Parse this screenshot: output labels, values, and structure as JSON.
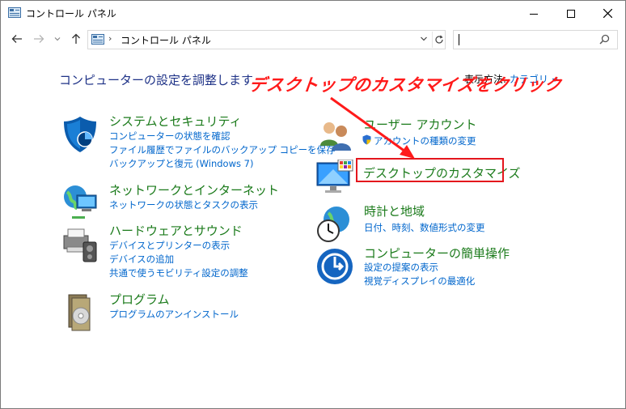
{
  "window": {
    "title": "コントロール パネル",
    "controls": {
      "minimize": "minimize-icon",
      "maximize": "maximize-icon",
      "close": "close-icon"
    }
  },
  "nav": {
    "breadcrumb": "コントロール パネル",
    "search_value": ""
  },
  "content": {
    "heading": "コンピューターの設定を調整します",
    "view_by_label": "表示方法:",
    "view_by_value": "カテゴリ",
    "categories_left": [
      {
        "title": "システムとセキュリティ",
        "links": [
          "コンピューターの状態を確認",
          "ファイル履歴でファイルのバックアップ コピーを保存",
          "バックアップと復元 (Windows 7)"
        ]
      },
      {
        "title": "ネットワークとインターネット",
        "links": [
          "ネットワークの状態とタスクの表示"
        ]
      },
      {
        "title": "ハードウェアとサウンド",
        "links": [
          "デバイスとプリンターの表示",
          "デバイスの追加",
          "共通で使うモビリティ設定の調整"
        ]
      },
      {
        "title": "プログラム",
        "links": [
          "プログラムのアンインストール"
        ]
      }
    ],
    "categories_right": [
      {
        "title": "ユーザー アカウント",
        "links": [
          "アカウントの種類の変更"
        ]
      },
      {
        "title": "デスクトップのカスタマイズ",
        "links": []
      },
      {
        "title": "時計と地域",
        "links": [
          "日付、時刻、数値形式の変更"
        ]
      },
      {
        "title": "コンピューターの簡単操作",
        "links": [
          "設定の提案の表示",
          "視覚ディスプレイの最適化"
        ]
      }
    ]
  },
  "annotation": {
    "text": "デスクトップのカスタマイズをクリック",
    "color": "#ff1a1a"
  },
  "colors": {
    "category_title": "#1a7a1a",
    "link": "#0066cc",
    "heading": "#1e3287"
  }
}
